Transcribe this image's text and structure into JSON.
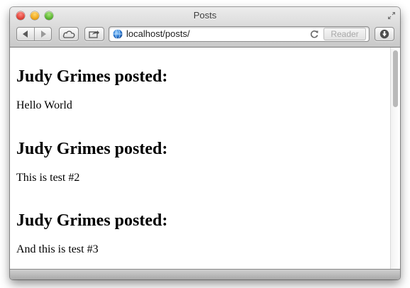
{
  "window": {
    "title": "Posts"
  },
  "toolbar": {
    "back_icon": "chevron-left-icon",
    "forward_icon": "chevron-right-icon",
    "icloud_icon": "cloud-icon",
    "share_icon": "share-icon",
    "download_icon": "download-icon",
    "reader_label": "Reader"
  },
  "address_bar": {
    "url": "localhost/posts/",
    "site_icon": "globe-icon",
    "reload_icon": "reload-icon"
  },
  "posts": [
    {
      "heading": "Judy Grimes posted:",
      "body": "Hello World"
    },
    {
      "heading": "Judy Grimes posted:",
      "body": "This is test #2"
    },
    {
      "heading": "Judy Grimes posted:",
      "body": "And this is test #3"
    }
  ],
  "colors": {
    "close": "#e0443a",
    "minimize": "#f0a81c",
    "zoom": "#5cb532"
  }
}
